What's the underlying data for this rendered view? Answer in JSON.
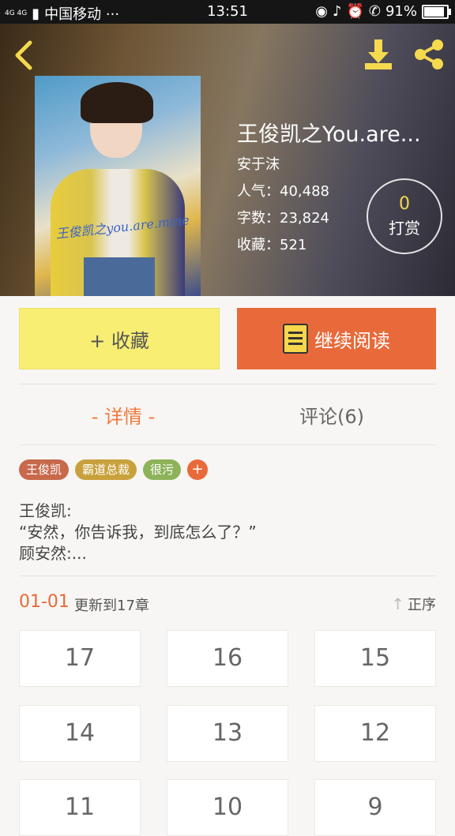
{
  "status_bar": {
    "carrier": "中国移动 ···",
    "network": "4G 4G",
    "time": "13:51",
    "battery": "91%",
    "battery_level": 0.91
  },
  "book": {
    "title": "王俊凯之You.are...",
    "author": "安于沫",
    "popularity": "人气：40,488",
    "word_count": "字数：23,824",
    "favorites": "收藏：521",
    "cover_caption": "王俊凯之you.are.mine"
  },
  "tip": {
    "count": "0",
    "label": "打赏"
  },
  "actions": {
    "favorite_label": "+ 收藏",
    "read_label": "继续阅读"
  },
  "tabs": [
    {
      "label": "- 详情 -"
    },
    {
      "label": "评论(6)"
    }
  ],
  "tags": [
    {
      "label": "王俊凯",
      "color": "#c8694c"
    },
    {
      "label": "霸道总裁",
      "color": "#c9a13c"
    },
    {
      "label": "很污",
      "color": "#8db35a"
    }
  ],
  "tag_add": "+",
  "synopsis": [
    "王俊凯:",
    "“安然，你告诉我，到底怎么了？”",
    "顾安然:..."
  ],
  "update": {
    "date": "01-01",
    "text": "更新到17章",
    "order_label": "正序"
  },
  "chapters": [
    "17",
    "16",
    "15",
    "14",
    "13",
    "12",
    "11",
    "10",
    "9"
  ],
  "colors": {
    "accent": "#e86a3a",
    "favorite_button": "#f8ee74",
    "icon_yellow": "#f5d94e"
  }
}
